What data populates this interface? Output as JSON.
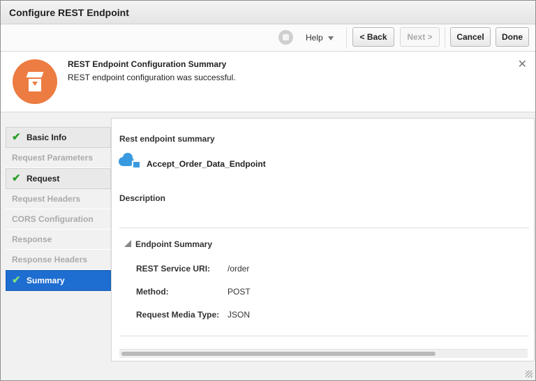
{
  "window": {
    "title": "Configure REST Endpoint"
  },
  "toolbar": {
    "help_label": "Help",
    "back_label": "< Back",
    "next_label": "Next >",
    "cancel_label": "Cancel",
    "done_label": "Done"
  },
  "banner": {
    "title": "REST Endpoint Configuration Summary",
    "message": "REST endpoint configuration was successful.",
    "icon": "wizard-badge-icon",
    "accent_color": "#ec7c42"
  },
  "sidebar": {
    "items": [
      {
        "label": "Basic Info",
        "state": "done"
      },
      {
        "label": "Request Parameters",
        "state": "disabled"
      },
      {
        "label": "Request",
        "state": "done"
      },
      {
        "label": "Request Headers",
        "state": "disabled"
      },
      {
        "label": "CORS Configuration",
        "state": "disabled"
      },
      {
        "label": "Response",
        "state": "disabled"
      },
      {
        "label": "Response Headers",
        "state": "disabled"
      },
      {
        "label": "Summary",
        "state": "active"
      }
    ],
    "active_color": "#1e6dd0",
    "check_color": "#2aa12a"
  },
  "summary": {
    "heading": "Rest endpoint summary",
    "endpoint_name": "Accept_Order_Data_Endpoint",
    "description_label": "Description",
    "section_title": "Endpoint Summary",
    "rows": [
      {
        "label": "REST Service URI:",
        "value": "/order"
      },
      {
        "label": "Method:",
        "value": "POST"
      },
      {
        "label": "Request Media Type:",
        "value": "JSON"
      }
    ]
  }
}
